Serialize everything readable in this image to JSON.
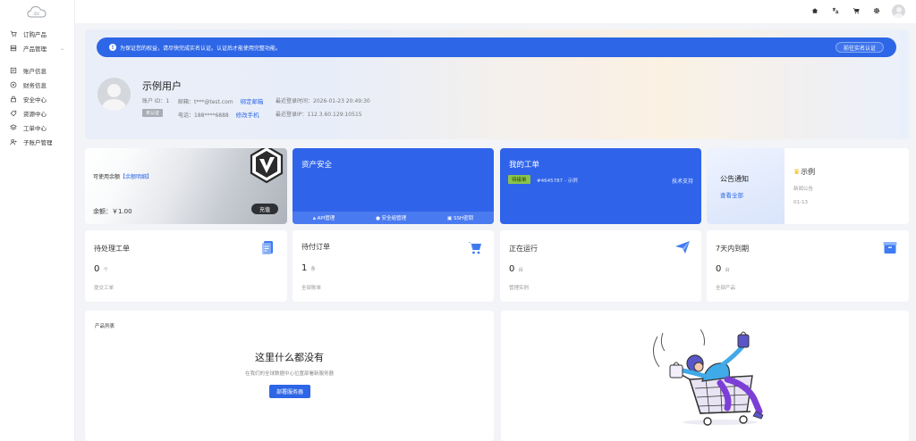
{
  "sidebar": {
    "items": [
      {
        "icon": "cart-icon",
        "label": "订购产品"
      },
      {
        "icon": "product-icon",
        "label": "产品管理"
      },
      {
        "icon": "account-icon",
        "label": "账户信息"
      },
      {
        "icon": "finance-icon",
        "label": "财务信息"
      },
      {
        "icon": "lock-icon",
        "label": "安全中心"
      },
      {
        "icon": "resource-icon",
        "label": "资源中心"
      },
      {
        "icon": "ticket-icon",
        "label": "工单中心"
      },
      {
        "icon": "subaccount-icon",
        "label": "子账户管理"
      }
    ]
  },
  "notice": {
    "text": "为保证您的权益，请尽快完成实名认证。认证后才能使用完整功能。",
    "button": "前往实名认证"
  },
  "user": {
    "name": "示例用户",
    "id_label": "账户 ID：",
    "id": "1",
    "email_label": "邮箱：",
    "email": "t***@test.com",
    "bind_email": "绑定邮箱",
    "last_login_time_label": "最近登录时间：",
    "last_login_time": "2026-01-23 20:49:30",
    "badge": "未认证",
    "phone_label": "电话：",
    "phone": "188****6888",
    "change_phone": "修改手机",
    "last_ip_label": "最近登录IP：",
    "last_ip": "112.3.60.129:10515"
  },
  "balance": {
    "label": "可使用余额",
    "detail_link": "【余额明细】",
    "amount": "余额：￥1.00",
    "recharge": "充值"
  },
  "security": {
    "title": "资产安全",
    "links": [
      "API管理",
      "安全组管理",
      "SSH密钥"
    ]
  },
  "tickets": {
    "title": "我的工单",
    "status": "待接单",
    "number": "#4645787 - 示例",
    "type": "技术支持"
  },
  "announcement": {
    "title": "公告通知",
    "view_all": "查看全部",
    "item_title": "示例",
    "item_category": "新闻公告",
    "item_date": "01-13"
  },
  "stats": [
    {
      "title": "待处理工单",
      "value": "0",
      "unit": "个",
      "sub": "提交工单",
      "icon": "ticket-doc-icon"
    },
    {
      "title": "待付订单",
      "value": "1",
      "unit": "条",
      "sub": "全部账单",
      "icon": "cart-icon"
    },
    {
      "title": "正在运行",
      "value": "0",
      "unit": "台",
      "sub": "管理实例",
      "icon": "paper-plane-icon"
    },
    {
      "title": "7天内到期",
      "value": "0",
      "unit": "台",
      "sub": "全部产品",
      "icon": "box-icon"
    }
  ],
  "products": {
    "label": "产品列表",
    "empty_title": "这里什么都没有",
    "empty_sub": "在我们的全球数据中心位置部署新服务器",
    "deploy_button": "部署服务器"
  },
  "colors": {
    "primary": "#2d66e6",
    "card_blue": "#2f63ea"
  }
}
